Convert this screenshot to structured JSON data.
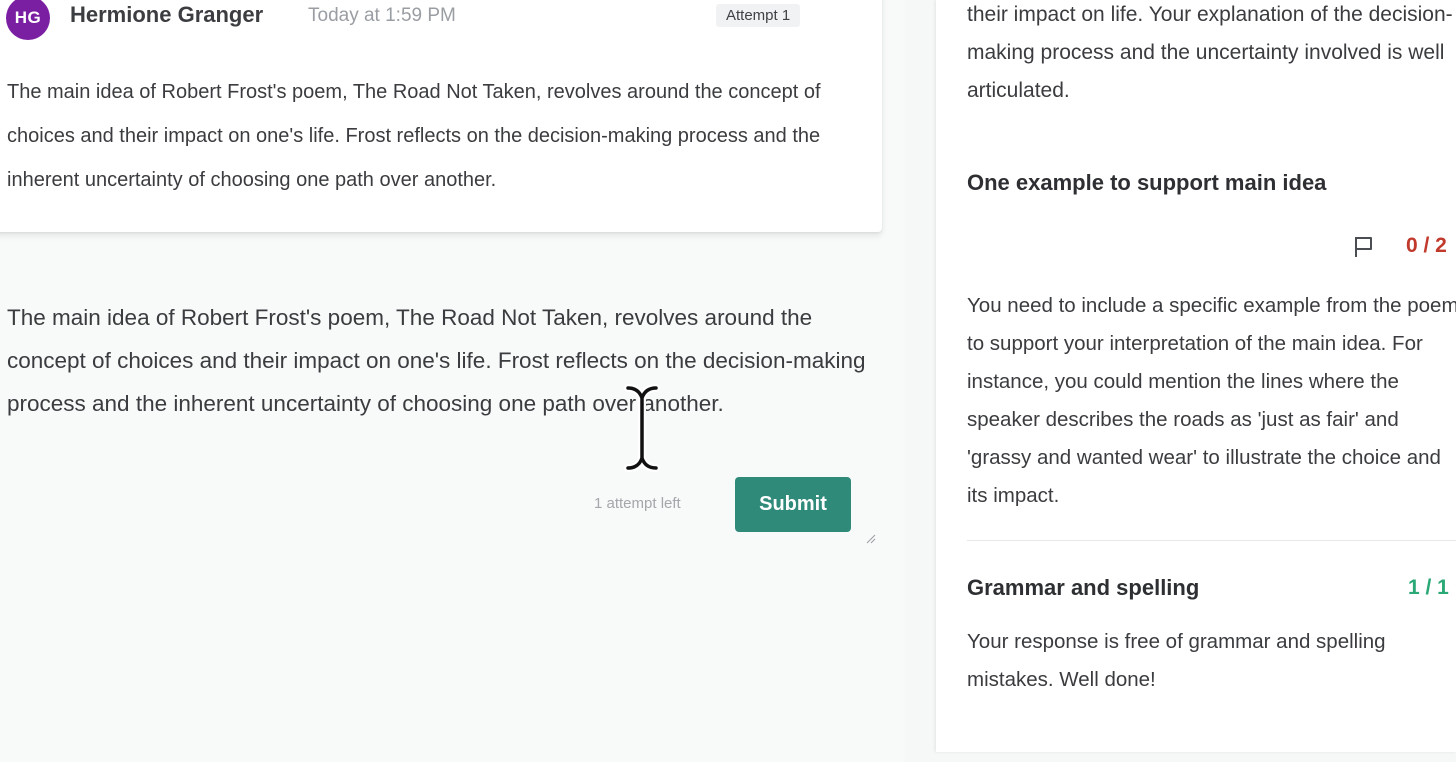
{
  "post": {
    "avatar_initials": "HG",
    "author": "Hermione Granger",
    "timestamp": "Today at 1:59 PM",
    "attempt_badge": "Attempt 1",
    "body": "The main idea of Robert Frost's poem, The Road Not Taken, revolves around the concept of choices and their impact on one's life. Frost reflects on the decision-making process and the inherent uncertainty of choosing one path over another."
  },
  "answer": {
    "text": "The main idea of Robert Frost's poem, The Road Not Taken, revolves around the concept of choices and their impact on one's life. Frost reflects on the decision-making process and the inherent uncertainty of choosing one path over another.",
    "attempts_note": "1 attempt left",
    "submit_label": "Submit"
  },
  "feedback_panel": {
    "intro": "their impact on life. Your explanation of the decision-making process and the uncertainty involved is well articulated.",
    "criteria": [
      {
        "title": "One example to support main idea",
        "score": "0 / 2",
        "feedback": "You need to include a specific example from the poem to support your interpretation of the main idea. For instance, you could mention the lines where the speaker describes the roads as 'just as fair' and 'grassy and wanted wear' to illustrate the choice and its impact."
      },
      {
        "title": "Grammar and spelling",
        "score": "1 / 1",
        "feedback": "Your response is free of grammar and spelling mistakes. Well done!"
      }
    ]
  },
  "colors": {
    "avatar": "#7b1fa2",
    "submit": "#2f8a7a",
    "score_bad": "#c0392b",
    "score_good": "#2aa876"
  },
  "icons": {
    "flag": "flag-icon",
    "resize": "resize-handle-icon",
    "cursor": "text-cursor-icon"
  }
}
